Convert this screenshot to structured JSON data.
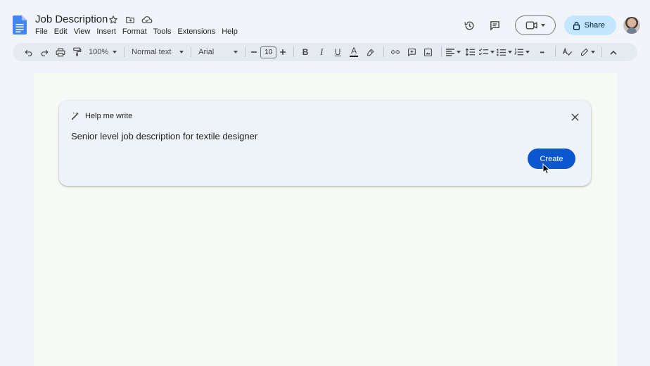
{
  "document": {
    "title": "Job Description"
  },
  "menu": [
    "File",
    "Edit",
    "View",
    "Insert",
    "Format",
    "Tools",
    "Extensions",
    "Help"
  ],
  "header": {
    "share_label": "Share"
  },
  "toolbar": {
    "zoom": "100%",
    "style": "Normal text",
    "font": "Arial",
    "font_size": "10",
    "bold": "B",
    "italic": "I",
    "underline": "U",
    "text_color_glyph": "A",
    "more": "•••"
  },
  "help_me_write": {
    "title": "Help me write",
    "prompt": "Senior level job description for textile designer",
    "create_label": "Create"
  },
  "colors": {
    "background": "#f1f4f8",
    "share_button": "#c2e7ff",
    "create_button": "#0b57d0",
    "docs_blue": "#4285f4"
  }
}
